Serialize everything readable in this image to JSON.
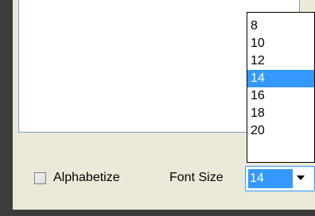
{
  "options": {
    "alphabetize_label": "Alphabetize",
    "alphabetize_checked": false,
    "font_size_label": "Font Size",
    "font_size_value": "14"
  },
  "font_size_dropdown": {
    "items": [
      {
        "label": "8"
      },
      {
        "label": "10"
      },
      {
        "label": "12"
      },
      {
        "label": "14",
        "selected": true
      },
      {
        "label": "16"
      },
      {
        "label": "18"
      },
      {
        "label": "20"
      }
    ]
  },
  "colors": {
    "selection": "#3399ff",
    "panel": "#ece9d8"
  }
}
